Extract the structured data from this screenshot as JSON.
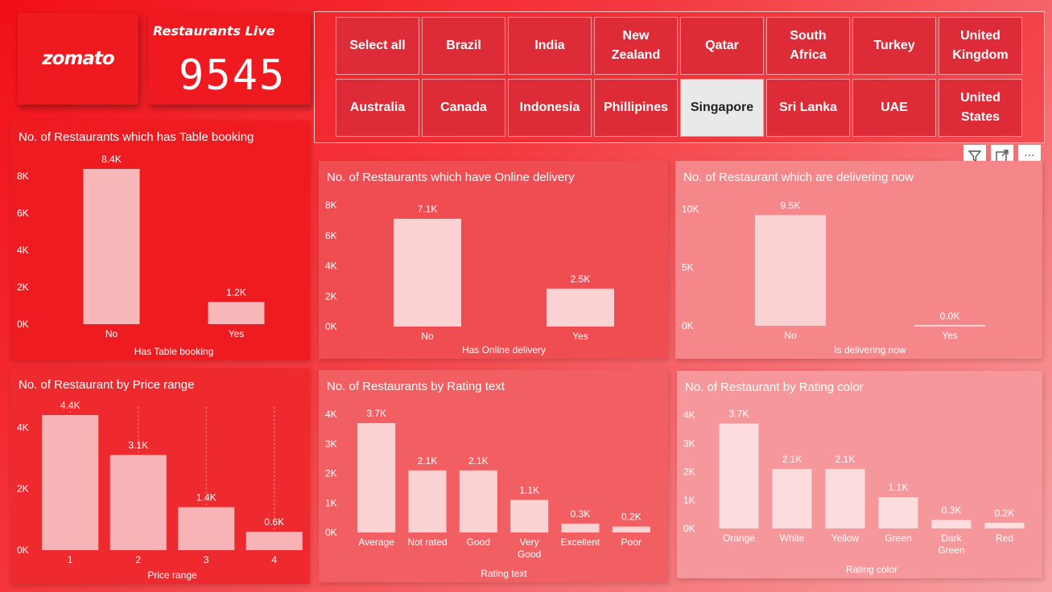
{
  "logo": {
    "text": "zomato"
  },
  "kpi": {
    "label": "Restaurants Live",
    "value": "9545"
  },
  "slicer": {
    "items": [
      {
        "label": "Select all",
        "selected": false
      },
      {
        "label": "Brazil",
        "selected": false
      },
      {
        "label": "India",
        "selected": false
      },
      {
        "label": "New\nZealand",
        "selected": false
      },
      {
        "label": "Qatar",
        "selected": false
      },
      {
        "label": "South\nAfrica",
        "selected": false
      },
      {
        "label": "Turkey",
        "selected": false
      },
      {
        "label": "United\nKingdom",
        "selected": false
      },
      {
        "label": "Australia",
        "selected": false
      },
      {
        "label": "Canada",
        "selected": false
      },
      {
        "label": "Indonesia",
        "selected": false
      },
      {
        "label": "Phillipines",
        "selected": false
      },
      {
        "label": "Singapore",
        "selected": true
      },
      {
        "label": "Sri Lanka",
        "selected": false
      },
      {
        "label": "UAE",
        "selected": false
      },
      {
        "label": "United\nStates",
        "selected": false
      }
    ]
  },
  "toolbar": {
    "filter_icon": "filter-icon",
    "focus_icon": "focus-mode-icon",
    "more_icon": "more-options-icon",
    "more_label": "···"
  },
  "chart_data": [
    {
      "id": "table_booking",
      "type": "bar",
      "title": "No. of Restaurants which has Table booking",
      "xlabel": "Has Table booking",
      "ylabel": "",
      "categories": [
        "No",
        "Yes"
      ],
      "values": [
        8400,
        1200
      ],
      "data_labels": [
        "8.4K",
        "1.2K"
      ],
      "yticks": [
        0,
        2000,
        4000,
        6000,
        8000
      ],
      "ytick_labels": [
        "0K",
        "2K",
        "4K",
        "6K",
        "8K"
      ],
      "ylim": [
        0,
        8400
      ],
      "grid": false,
      "bar_color": "#f8b7b9",
      "panel_bg": "#ee1c20"
    },
    {
      "id": "online_delivery",
      "type": "bar",
      "title": "No. of Restaurants which have Online delivery",
      "xlabel": "Has Online delivery",
      "ylabel": "",
      "categories": [
        "No",
        "Yes"
      ],
      "values": [
        7100,
        2500
      ],
      "data_labels": [
        "7.1K",
        "2.5K"
      ],
      "yticks": [
        0,
        2000,
        4000,
        6000,
        8000
      ],
      "ytick_labels": [
        "0K",
        "2K",
        "4K",
        "6K",
        "8K"
      ],
      "ylim": [
        0,
        8000
      ],
      "grid": false,
      "bar_color": "#fbd2d3",
      "panel_bg": "#f04d52"
    },
    {
      "id": "delivering_now",
      "type": "bar",
      "title": "No. of Restaurant which are delivering now",
      "xlabel": "Is delivering now",
      "ylabel": "",
      "categories": [
        "No",
        "Yes"
      ],
      "values": [
        9500,
        0
      ],
      "data_labels": [
        "9.5K",
        "0.0K"
      ],
      "yticks": [
        0,
        5000,
        10000
      ],
      "ytick_labels": [
        "0K",
        "5K",
        "10K"
      ],
      "ylim": [
        0,
        10000
      ],
      "grid": false,
      "bar_color": "#fbd2d3",
      "panel_bg": "#f5878a"
    },
    {
      "id": "price_range",
      "type": "bar",
      "title": "No. of Restaurant by Price range",
      "xlabel": "Price range",
      "ylabel": "",
      "categories": [
        "1",
        "2",
        "3",
        "4"
      ],
      "values": [
        4400,
        3100,
        1400,
        600
      ],
      "data_labels": [
        "4.4K",
        "3.1K",
        "1.4K",
        "0.6K"
      ],
      "yticks": [
        0,
        2000,
        4000
      ],
      "ytick_labels": [
        "0K",
        "2K",
        "4K"
      ],
      "ylim": [
        0,
        4400
      ],
      "grid": true,
      "bar_color": "#f8b3b6",
      "panel_bg": "#ef2a2f"
    },
    {
      "id": "rating_text",
      "type": "bar",
      "title": "No. of Restaurants by Rating text",
      "xlabel": "Rating text",
      "ylabel": "",
      "categories": [
        "Average",
        "Not rated",
        "Good",
        "Very\nGood",
        "Excellent",
        "Poor"
      ],
      "values": [
        3700,
        2100,
        2100,
        1100,
        300,
        200
      ],
      "data_labels": [
        "3.7K",
        "2.1K",
        "2.1K",
        "1.1K",
        "0.3K",
        "0.2K"
      ],
      "yticks": [
        0,
        1000,
        2000,
        3000,
        4000
      ],
      "ytick_labels": [
        "0K",
        "1K",
        "2K",
        "3K",
        "4K"
      ],
      "ylim": [
        0,
        4000
      ],
      "grid": false,
      "bar_color": "#fbd2d3",
      "panel_bg": "#f25f63"
    },
    {
      "id": "rating_color",
      "type": "bar",
      "title": "No. of Restaurant by Rating color",
      "xlabel": "Rating color",
      "ylabel": "",
      "categories": [
        "Orange",
        "White",
        "Yellow",
        "Green",
        "Dark\nGreen",
        "Red"
      ],
      "values": [
        3700,
        2100,
        2100,
        1100,
        300,
        200
      ],
      "data_labels": [
        "3.7K",
        "2.1K",
        "2.1K",
        "1.1K",
        "0.3K",
        "0.2K"
      ],
      "yticks": [
        0,
        1000,
        2000,
        3000,
        4000
      ],
      "ytick_labels": [
        "0K",
        "1K",
        "2K",
        "3K",
        "4K"
      ],
      "ylim": [
        0,
        4000
      ],
      "grid": false,
      "bar_color": "#fcdcdd",
      "panel_bg": "#f6989b"
    }
  ]
}
